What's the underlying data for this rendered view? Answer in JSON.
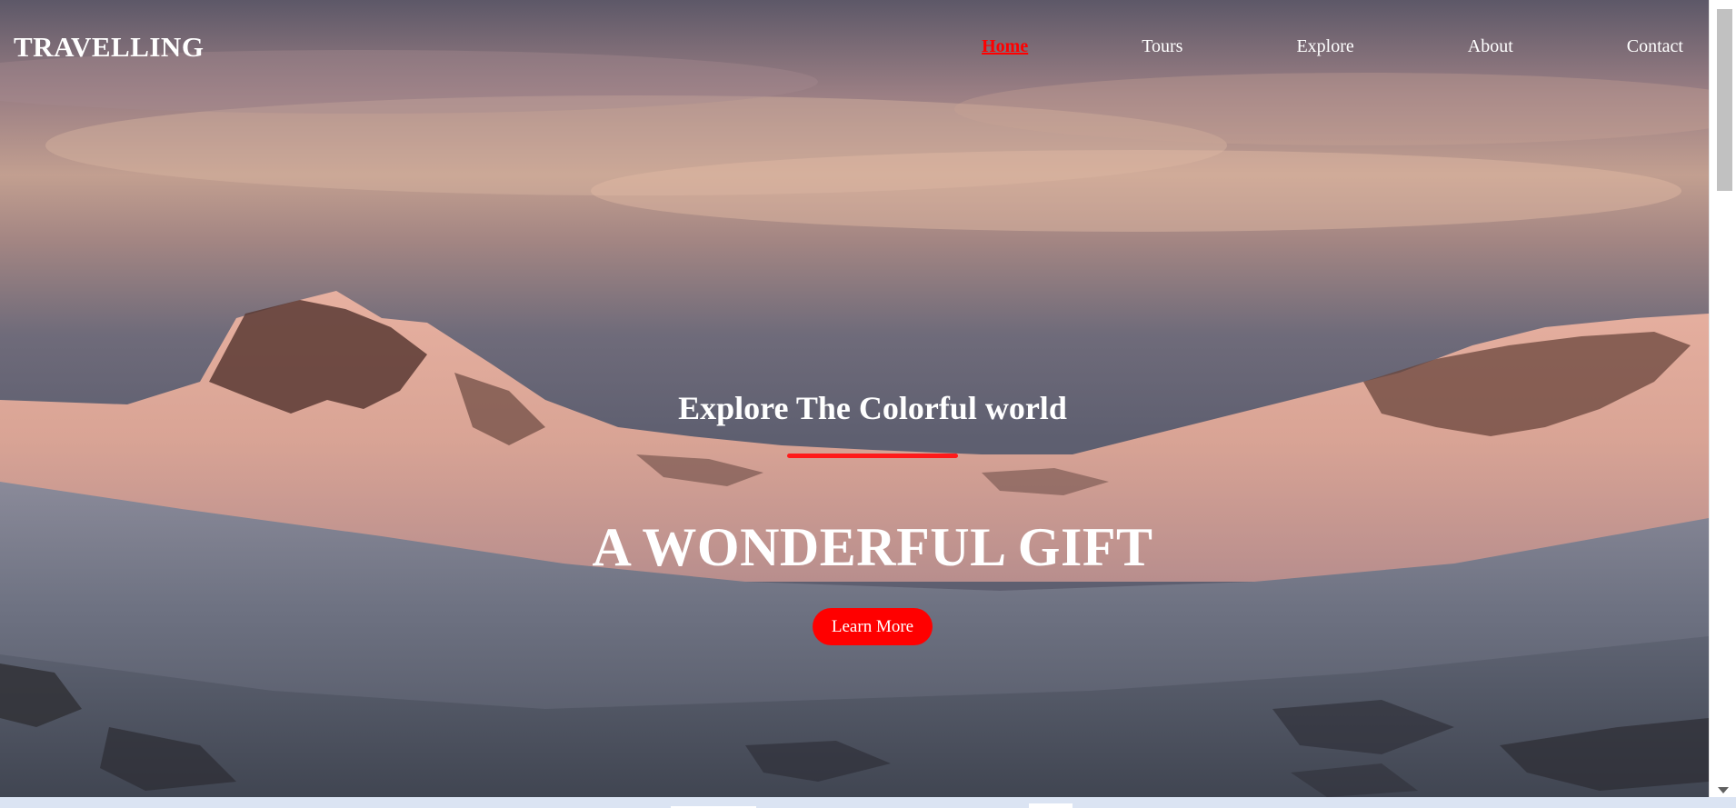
{
  "header": {
    "brand": "TRAVELLING",
    "nav": [
      {
        "label": "Home",
        "active": true
      },
      {
        "label": "Tours",
        "active": false
      },
      {
        "label": "Explore",
        "active": false
      },
      {
        "label": "About",
        "active": false
      },
      {
        "label": "Contact",
        "active": false
      }
    ]
  },
  "hero": {
    "subtitle": "Explore The Colorful world",
    "headline": "A WONDERFUL GIFT",
    "cta_label": "Learn More",
    "background": "snowy-mountain-sunset"
  },
  "colors": {
    "accent": "#ff0000",
    "text": "#ffffff"
  }
}
